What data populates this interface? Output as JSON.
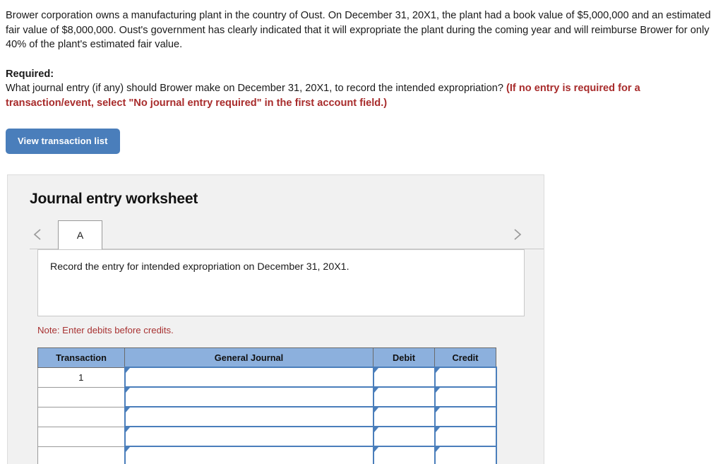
{
  "problem": {
    "paragraph": "Brower corporation owns a manufacturing plant in the country of Oust. On December 31, 20X1, the plant had a book value of $5,000,000 and an estimated fair value of $8,000,000. Oust's government has clearly indicated that it will expropriate the plant during the coming year and will reimburse Brower for only 40% of the plant's estimated fair value."
  },
  "required": {
    "label": "Required:",
    "question": "What journal entry (if any) should Brower make on December 31, 20X1, to record the intended expropriation? ",
    "hint": "(If no entry is required for a transaction/event, select \"No journal entry required\" in the first account field.)"
  },
  "toolbar": {
    "view_transaction_label": "View transaction list"
  },
  "worksheet": {
    "title": "Journal entry worksheet",
    "tabs": [
      {
        "label": "A",
        "active": true
      }
    ],
    "prev_icon": "chevron-left-icon",
    "next_icon": "chevron-right-icon",
    "instruction": "Record the entry for intended expropriation on December 31, 20X1.",
    "note": "Note: Enter debits before credits.",
    "table": {
      "headers": [
        "Transaction",
        "General Journal",
        "Debit",
        "Credit"
      ],
      "rows": [
        {
          "transaction": "1",
          "general_journal": "",
          "debit": "",
          "credit": ""
        },
        {
          "transaction": "",
          "general_journal": "",
          "debit": "",
          "credit": ""
        },
        {
          "transaction": "",
          "general_journal": "",
          "debit": "",
          "credit": ""
        },
        {
          "transaction": "",
          "general_journal": "",
          "debit": "",
          "credit": ""
        },
        {
          "transaction": "",
          "general_journal": "",
          "debit": "",
          "credit": ""
        }
      ]
    }
  },
  "colors": {
    "accent_blue": "#4a7ebb",
    "header_blue": "#8cb0dd",
    "alert_red": "#a82c2c",
    "panel_gray": "#f1f1f1"
  }
}
